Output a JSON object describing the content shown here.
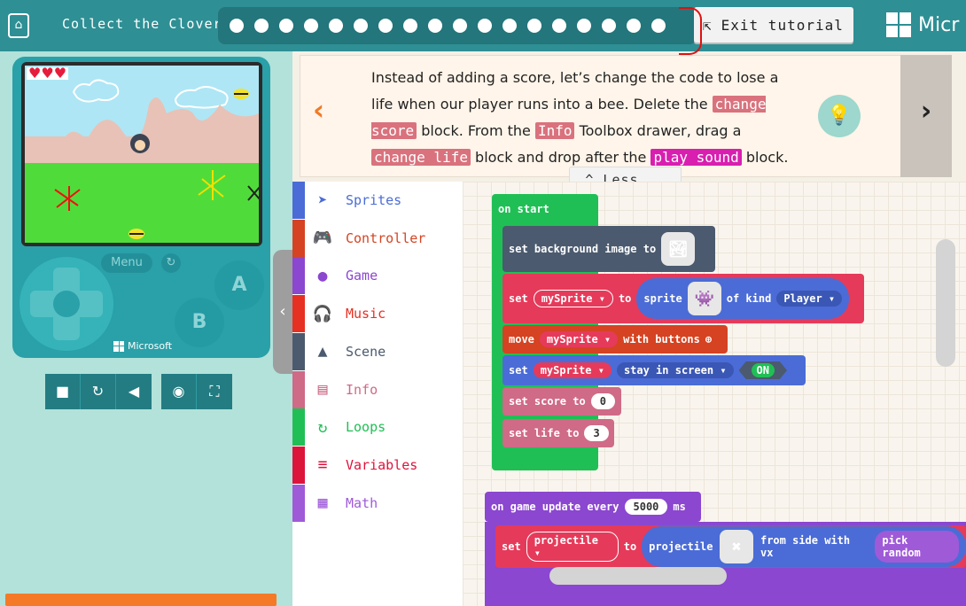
{
  "header": {
    "tutorial_title": "Collect the Clovers",
    "step_count": 18,
    "exit_label": "Exit tutorial",
    "brand": "Micr"
  },
  "simulator": {
    "hearts": "♥♥♥",
    "menu_label": "Menu",
    "btn_a": "A",
    "btn_b": "B",
    "brand": "Microsoft",
    "toolbar_icons": [
      "stop-icon",
      "restart-icon",
      "mute-icon",
      "screenshot-icon",
      "fullscreen-icon"
    ]
  },
  "instruction": {
    "t1": "Instead of adding a score, let’s change the code to lose a life when our player runs into a bee. Delete the ",
    "c1": "change score",
    "t2": " block. From the ",
    "c2": "Info",
    "t3": " Toolbox drawer, drag a ",
    "c3": "change life",
    "t4": " block and drop after the ",
    "c4": "play sound",
    "t5": " block.",
    "less_label": "Less..."
  },
  "toolbox": [
    {
      "label": "Sprites",
      "color": "#4b6cd6",
      "icon": "➤"
    },
    {
      "label": "Controller",
      "color": "#d54322",
      "icon": "🎮"
    },
    {
      "label": "Game",
      "color": "#8b47cf",
      "icon": "●"
    },
    {
      "label": "Music",
      "color": "#e63022",
      "icon": "🎧"
    },
    {
      "label": "Scene",
      "color": "#4b5a6e",
      "icon": "▲"
    },
    {
      "label": "Info",
      "color": "#cf6a87",
      "icon": "▤"
    },
    {
      "label": "Loops",
      "color": "#20bf55",
      "icon": "↻"
    },
    {
      "label": "Variables",
      "color": "#dc143c",
      "icon": "≡"
    },
    {
      "label": "Math",
      "color": "#9f5ad8",
      "icon": "▦"
    }
  ],
  "blocks": {
    "on_start": "on start",
    "set_bg": "set background image to",
    "set": "set",
    "my_sprite": "mySprite",
    "to": "to",
    "sprite": "sprite",
    "of_kind": "of kind",
    "player": "Player",
    "move": "move",
    "with_buttons": "with buttons",
    "stay_in_screen": "stay in screen",
    "on": "ON",
    "set_score_to": "set score to",
    "score_val": "0",
    "set_life_to": "set life to",
    "life_val": "3",
    "on_game_update": "on game update every",
    "interval": "5000",
    "ms": "ms",
    "projectile_var": "projectile",
    "projectile": "projectile",
    "from_side": "from side with vx",
    "pick_random": "pick random"
  }
}
